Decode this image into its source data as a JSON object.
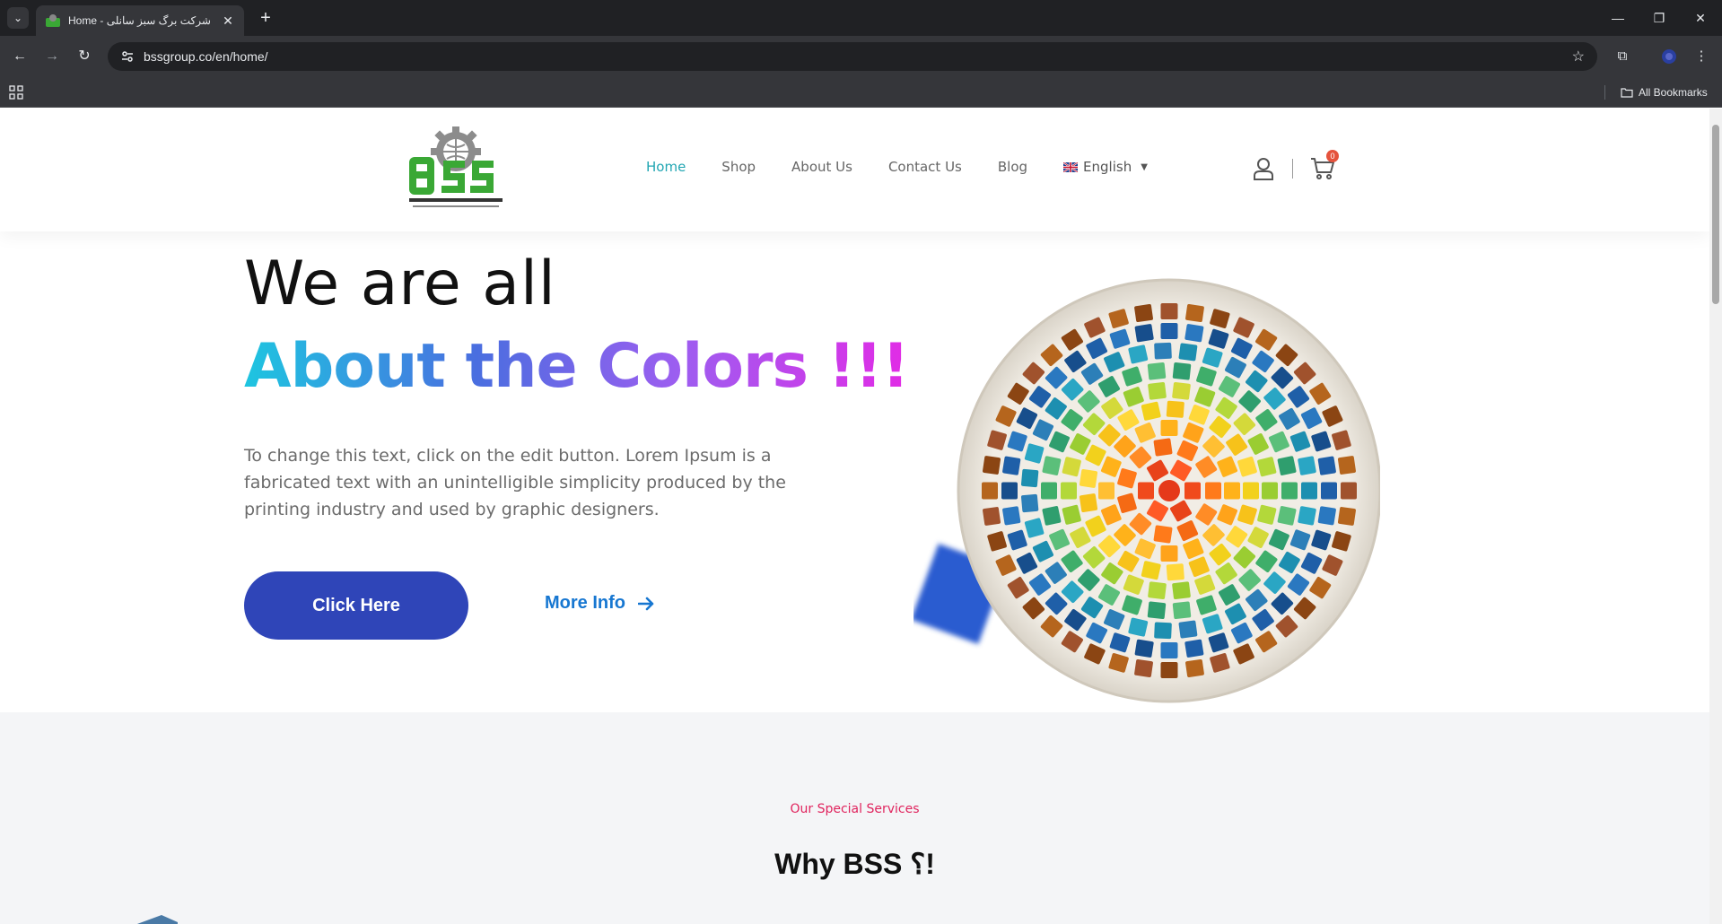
{
  "browser": {
    "tab_title": "Home - شرکت برگ سبز سانلی",
    "url": "bssgroup.co/en/home/",
    "bookmarks_label": "All Bookmarks",
    "icons": [
      "tab-search-icon",
      "close-icon",
      "plus-icon",
      "minimize-icon",
      "restore-icon",
      "close-window-icon",
      "back-icon",
      "forward-icon",
      "reload-icon",
      "site-info-icon",
      "star-icon",
      "extensions-icon",
      "profile-icon",
      "menu-icon",
      "apps-icon",
      "folder-icon"
    ]
  },
  "header": {
    "nav": [
      {
        "label": "Home",
        "active": true
      },
      {
        "label": "Shop"
      },
      {
        "label": "About Us"
      },
      {
        "label": "Contact Us"
      },
      {
        "label": "Blog"
      }
    ],
    "language": "English",
    "cart_count": "0",
    "brand_color": "#3aa835"
  },
  "hero": {
    "line1": "We are all",
    "line2": "About the Colors !!!",
    "text": "To change this text, click on the edit button. Lorem Ipsum is a fabricated text with an unintelligible simplicity produced by the printing industry and used by graphic designers.",
    "button": "Click Here",
    "more_info": "More Info",
    "accent": "#2f45b8"
  },
  "services": {
    "kicker": "Our Special Services",
    "title": "Why BSS ؟!"
  }
}
